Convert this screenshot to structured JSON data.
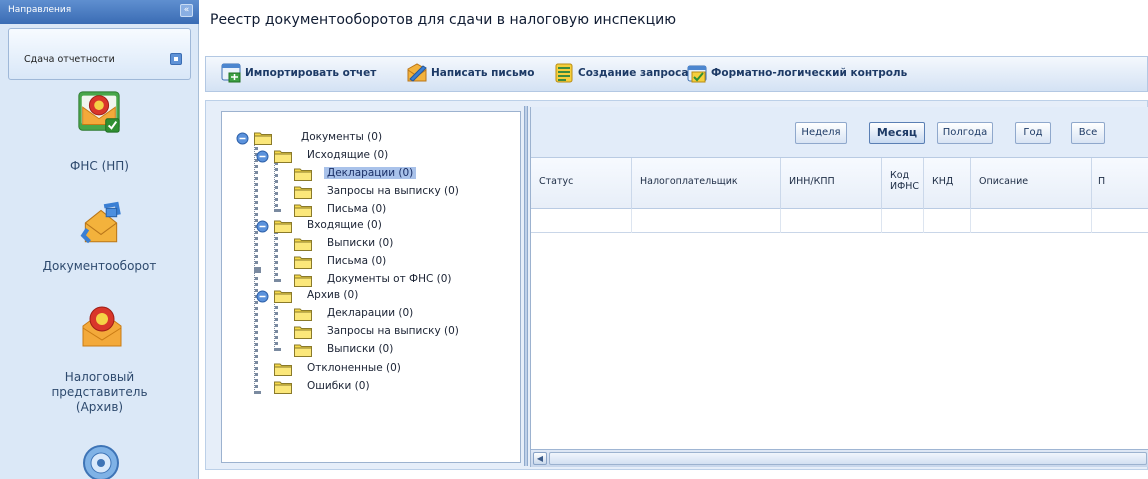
{
  "nav": {
    "header": "Направления",
    "tab_label": "Сдача отчетности",
    "items": [
      {
        "label_lines": [
          "ФНС (НП)"
        ],
        "icon": "fns-icon"
      },
      {
        "label_lines": [
          "Документооборот"
        ],
        "icon": "document-exchange-icon"
      },
      {
        "label_lines": [
          "Налоговый",
          "представитель",
          "(Архив)"
        ],
        "icon": "tax-archive-icon"
      },
      {
        "label_lines": [],
        "icon": "globe-icon"
      }
    ]
  },
  "page": {
    "title": "Реестр документооборотов для сдачи в налоговую инспекцию"
  },
  "toolbar": {
    "import_label": "Импортировать отчет",
    "letter_label": "Написать письмо",
    "request_label": "Создание запроса",
    "flk_label": "Форматно-логический контроль"
  },
  "tree": {
    "root": "Документы (0)",
    "outgoing": "Исходящие (0)",
    "outgoing_declarations": "Декларации (0)",
    "outgoing_requests": "Запросы на выписку (0)",
    "outgoing_letters": "Письма (0)",
    "incoming": "Входящие (0)",
    "incoming_statements": "Выписки (0)",
    "incoming_letters": "Письма (0)",
    "incoming_fns_docs": "Документы от ФНС (0)",
    "archive": "Архив (0)",
    "archive_declarations": "Декларации (0)",
    "archive_requests": "Запросы на выписку (0)",
    "archive_statements": "Выписки (0)",
    "rejected": "Отклоненные (0)",
    "errors": "Ошибки (0)"
  },
  "period": {
    "week": "Неделя",
    "month": "Месяц",
    "half_year": "Полгода",
    "year": "Год",
    "all": "Все",
    "selected": "Месяц"
  },
  "grid": {
    "columns": [
      "Статус",
      "Налогоплательщик",
      "ИНН/КПП",
      "Код\nИФНС",
      "КНД",
      "Описание",
      "П"
    ]
  },
  "colors": {
    "nav_bg": "#dbe8f7",
    "header_blue": "#3a6cb4",
    "selection": "#a9c2ea",
    "folder_yellow": "#f6d94a"
  }
}
